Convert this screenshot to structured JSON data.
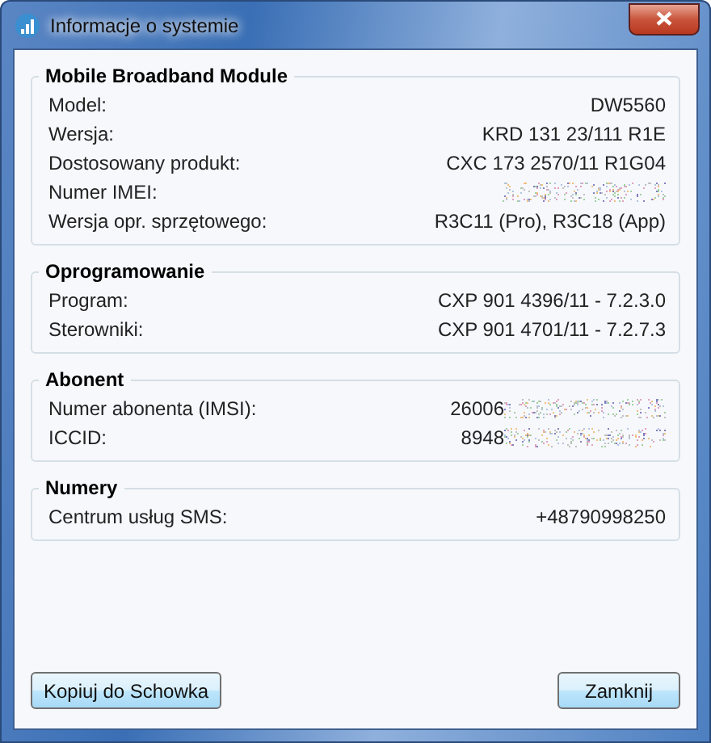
{
  "window": {
    "title": "Informacje o systemie"
  },
  "groups": [
    {
      "title": "Mobile Broadband Module",
      "rows": [
        {
          "label": "Model:",
          "value": "DW5560",
          "redacted": false
        },
        {
          "label": "Wersja:",
          "value": "KRD 131 23/111 R1E",
          "redacted": false
        },
        {
          "label": "Dostosowany produkt:",
          "value": "CXC 173 2570/11 R1G04",
          "redacted": false
        },
        {
          "label": "Numer IMEI:",
          "redacted": true
        },
        {
          "label": "Wersja opr. sprzętowego:",
          "value": "R3C11 (Pro), R3C18 (App)",
          "redacted": false
        }
      ]
    },
    {
      "title": "Oprogramowanie",
      "rows": [
        {
          "label": "Program:",
          "value": "CXP 901 4396/11 - 7.2.3.0",
          "redacted": false
        },
        {
          "label": "Sterowniki:",
          "value": "CXP 901 4701/11 - 7.2.7.3",
          "redacted": false
        }
      ]
    },
    {
      "title": "Abonent",
      "rows": [
        {
          "label": "Numer abonenta (IMSI):",
          "value": "26006",
          "redacted": true
        },
        {
          "label": "ICCID:",
          "value": "8948",
          "redacted": true
        }
      ]
    },
    {
      "title": "Numery",
      "rows": [
        {
          "label": "Centrum usług SMS:",
          "value": "+48790998250",
          "redacted": false
        }
      ]
    }
  ],
  "buttons": [
    "Kopiuj do Schowka",
    "Zamknij"
  ]
}
